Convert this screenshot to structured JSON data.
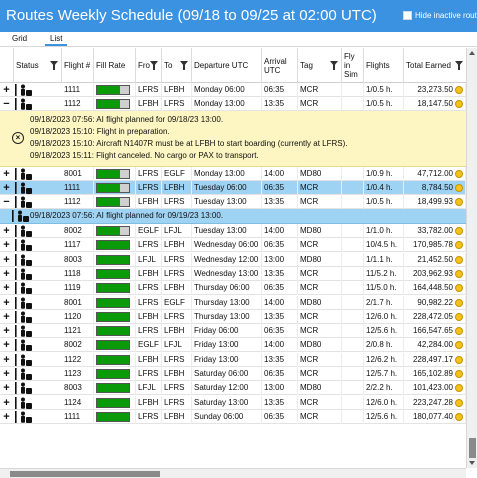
{
  "window": {
    "title": "Routes Weekly Schedule (09/18 to 09/25 at 02:00 UTC)",
    "hide_inactive_label": "Hide inactive routes"
  },
  "tabs": [
    {
      "label": "Grid",
      "active": false
    },
    {
      "label": "List",
      "active": true
    }
  ],
  "columns": {
    "status": "Status",
    "flight": "Flight #",
    "fill_rate": "Fill Rate",
    "from": "Fro",
    "to": "To",
    "departure": "Departure UTC",
    "arrival": "Arrival UTC",
    "tag": "Tag",
    "fly_in_sim": "Fly in Sim",
    "flights": "Flights",
    "total_earned": "Total Earned"
  },
  "rows_top": [
    {
      "expander": "+",
      "flight": "1111",
      "fill": 0.72,
      "from": "LFRS",
      "to": "LFBH",
      "departure": "Monday 06:00",
      "arrival": "06:35",
      "tag": "MCR",
      "flights": "1/0.5 h.",
      "earned": "23,273.50"
    },
    {
      "expander": "−",
      "flight": "1112",
      "fill": 0.72,
      "from": "LFBH",
      "to": "LFRS",
      "departure": "Monday 13:00",
      "arrival": "13:35",
      "tag": "MCR",
      "flights": "1/0.5 h.",
      "earned": "18,147.50"
    }
  ],
  "details_warning": [
    "09/18/2023 07:56: AI flight planned for 09/18/23 13:00.",
    "09/18/2023 15:10: Flight in preparation.",
    "09/18/2023 15:10: Aircraft N1407R must be at LFBH to start boarding (currently at LFRS).",
    "09/18/2023 15:11: Flight canceled. No cargo or PAX to transport."
  ],
  "rows_mid": [
    {
      "expander": "+",
      "flight": "8001",
      "fill": 0.72,
      "from": "LFRS",
      "to": "EGLF",
      "departure": "Monday 13:00",
      "arrival": "14:00",
      "tag": "MD80",
      "flights": "1/0.9 h.",
      "earned": "47,712.00",
      "selected": false
    },
    {
      "expander": "+",
      "flight": "1111",
      "fill": 0.72,
      "from": "LFRS",
      "to": "LFBH",
      "departure": "Tuesday 06:00",
      "arrival": "06:35",
      "tag": "MCR",
      "flights": "1/0.4 h.",
      "earned": "8,784.50",
      "selected": true
    },
    {
      "expander": "−",
      "flight": "1112",
      "fill": 0.72,
      "from": "LFBH",
      "to": "LFRS",
      "departure": "Tuesday 13:00",
      "arrival": "13:35",
      "tag": "MCR",
      "flights": "1/0.5 h.",
      "earned": "18,499.93",
      "selected": false
    }
  ],
  "details_info": "09/18/2023 07:56: AI flight planned for 09/19/23 13:00.",
  "rows_bottom": [
    {
      "flight": "8002",
      "fill": 0.72,
      "from": "EGLF",
      "to": "LFJL",
      "departure": "Tuesday 13:00",
      "arrival": "14:00",
      "tag": "MD80",
      "flights": "1/1.0 h.",
      "earned": "33,782.00"
    },
    {
      "flight": "1117",
      "fill": 1.0,
      "from": "LFRS",
      "to": "LFBH",
      "departure": "Wednesday 06:00",
      "arrival": "06:35",
      "tag": "MCR",
      "flights": "10/4.5 h.",
      "earned": "170,985.78"
    },
    {
      "flight": "8003",
      "fill": 1.0,
      "from": "LFJL",
      "to": "LFRS",
      "departure": "Wednesday 12:00",
      "arrival": "13:00",
      "tag": "MD80",
      "flights": "1/1.1 h.",
      "earned": "21,452.50"
    },
    {
      "flight": "1118",
      "fill": 1.0,
      "from": "LFBH",
      "to": "LFRS",
      "departure": "Wednesday 13:00",
      "arrival": "13:35",
      "tag": "MCR",
      "flights": "11/5.2 h.",
      "earned": "203,962.93"
    },
    {
      "flight": "1119",
      "fill": 1.0,
      "from": "LFRS",
      "to": "LFBH",
      "departure": "Thursday 06:00",
      "arrival": "06:35",
      "tag": "MCR",
      "flights": "11/5.0 h.",
      "earned": "164,448.50"
    },
    {
      "flight": "8001",
      "fill": 1.0,
      "from": "LFRS",
      "to": "EGLF",
      "departure": "Thursday 13:00",
      "arrival": "14:00",
      "tag": "MD80",
      "flights": "2/1.7 h.",
      "earned": "90,982.22"
    },
    {
      "flight": "1120",
      "fill": 1.0,
      "from": "LFBH",
      "to": "LFRS",
      "departure": "Thursday 13:00",
      "arrival": "13:35",
      "tag": "MCR",
      "flights": "12/6.0 h.",
      "earned": "228,472.05"
    },
    {
      "flight": "1121",
      "fill": 1.0,
      "from": "LFRS",
      "to": "LFBH",
      "departure": "Friday 06:00",
      "arrival": "06:35",
      "tag": "MCR",
      "flights": "12/5.6 h.",
      "earned": "166,547.65"
    },
    {
      "flight": "8002",
      "fill": 1.0,
      "from": "EGLF",
      "to": "LFJL",
      "departure": "Friday 13:00",
      "arrival": "14:00",
      "tag": "MD80",
      "flights": "2/0.8 h.",
      "earned": "42,284.00"
    },
    {
      "flight": "1122",
      "fill": 1.0,
      "from": "LFBH",
      "to": "LFRS",
      "departure": "Friday 13:00",
      "arrival": "13:35",
      "tag": "MCR",
      "flights": "12/6.2 h.",
      "earned": "228,497.17"
    },
    {
      "flight": "1123",
      "fill": 1.0,
      "from": "LFRS",
      "to": "LFBH",
      "departure": "Saturday 06:00",
      "arrival": "06:35",
      "tag": "MCR",
      "flights": "12/5.7 h.",
      "earned": "165,102.89"
    },
    {
      "flight": "8003",
      "fill": 1.0,
      "from": "LFJL",
      "to": "LFRS",
      "departure": "Saturday 12:00",
      "arrival": "13:00",
      "tag": "MD80",
      "flights": "2/2.2 h.",
      "earned": "101,423.00"
    },
    {
      "flight": "1124",
      "fill": 1.0,
      "from": "LFBH",
      "to": "LFRS",
      "departure": "Saturday 13:00",
      "arrival": "13:35",
      "tag": "MCR",
      "flights": "12/6.0 h.",
      "earned": "223,247.28"
    },
    {
      "flight": "1111",
      "fill": 1.0,
      "from": "LFRS",
      "to": "LFBH",
      "departure": "Sunday 06:00",
      "arrival": "06:35",
      "tag": "MCR",
      "flights": "12/5.6 h.",
      "earned": "180,077.40"
    }
  ],
  "colors": {
    "titlebar": "#3b92e1",
    "selected": "#9ed3f3",
    "warning": "#fdf6c2",
    "fill": "#0a9a0a"
  }
}
